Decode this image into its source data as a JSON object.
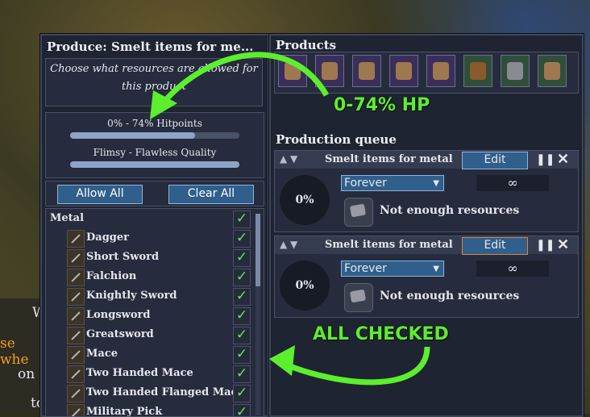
{
  "left_panel": {
    "title": "Produce: Smelt items for me...",
    "description": "Choose what resources are allowed for this product",
    "hp_filter_label": "0% - 74% Hitpoints",
    "hp_filter_max": 0.74,
    "quality_filter_label": "Flimsy - Flawless Quality",
    "allow_all_label": "Allow All",
    "clear_all_label": "Clear All",
    "category": "Metal",
    "items": [
      "Dagger",
      "Short Sword",
      "Falchion",
      "Knightly Sword",
      "Longsword",
      "Greatsword",
      "Mace",
      "Two Handed Mace",
      "Two Handed Flanged Mace",
      "Military Pick"
    ],
    "checkmark": "✓"
  },
  "products": {
    "title": "Products",
    "icons": [
      "leather-armor-icon",
      "brown-vest-icon",
      "white-tunic-icon",
      "leather-helmet-icon",
      "great-helm-icon",
      "round-shield-icon",
      "metal-ingot-icon",
      "cloth-icon"
    ]
  },
  "queue": {
    "title": "Production queue",
    "items": [
      {
        "name": "Smelt items for metal",
        "edit": "Edit",
        "progress": "0%",
        "mode": "Forever",
        "count": "∞",
        "status": "Not enough resources"
      },
      {
        "name": "Smelt items for metal",
        "edit": "Edit",
        "progress": "0%",
        "mode": "Forever",
        "count": "∞",
        "status": "Not enough resources"
      }
    ]
  },
  "annotations": {
    "hp": "0-74% HP",
    "checked": "ALL CHECKED",
    "color": "#5cef2d"
  },
  "background_text": {
    "line1": "W",
    "line2": "se whe",
    "line3": "on",
    "line4": "to"
  }
}
